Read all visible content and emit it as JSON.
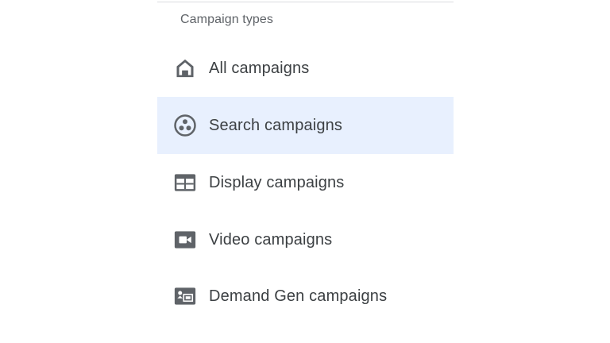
{
  "menu": {
    "section_title": "Campaign types",
    "items": [
      {
        "label": "All campaigns",
        "icon": "home-icon",
        "selected": false
      },
      {
        "label": "Search campaigns",
        "icon": "search-network-icon",
        "selected": true
      },
      {
        "label": "Display campaigns",
        "icon": "display-layout-icon",
        "selected": false
      },
      {
        "label": "Video campaigns",
        "icon": "video-camera-icon",
        "selected": false
      },
      {
        "label": "Demand Gen campaigns",
        "icon": "demand-gen-icon",
        "selected": false
      }
    ]
  },
  "colors": {
    "icon": "#5f6368",
    "text": "#3c4043",
    "selected_background": "#e8f0fe",
    "divider": "#dadce0"
  }
}
